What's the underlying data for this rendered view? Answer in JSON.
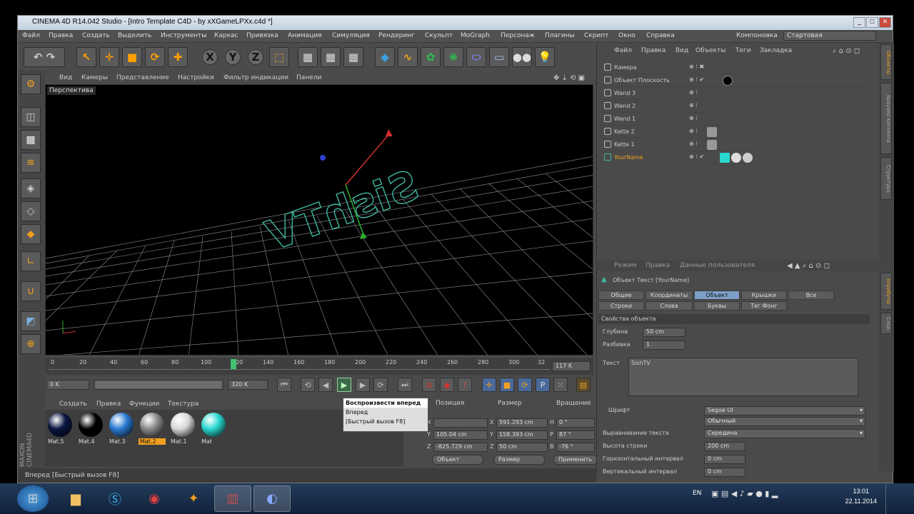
{
  "window": {
    "title": "CINEMA 4D R14.042 Studio - [Intro Template C4D - by xXGameLPXx.c4d *]"
  },
  "menu": [
    "Файл",
    "Правка",
    "Создать",
    "Выделить",
    "Инструменты",
    "Каркас",
    "Привязка",
    "Анимация",
    "Симуляция",
    "Рендеринг",
    "Скульпт",
    "MoGraph",
    "Персонаж",
    "Плагины",
    "Скрипт",
    "Окно",
    "Справка"
  ],
  "layout": {
    "label": "Компоновка",
    "value": "Стартовая"
  },
  "viewport": {
    "menu": [
      "Вид",
      "Камеры",
      "Представление",
      "Настройки",
      "Фильтр индикации",
      "Панели"
    ],
    "label": "Перспектива"
  },
  "timeline": {
    "ticks": [
      "0",
      "20",
      "40",
      "60",
      "80",
      "100",
      "120",
      "140",
      "160",
      "180",
      "200",
      "220",
      "240",
      "260",
      "280",
      "300",
      "32"
    ],
    "current": "117 K"
  },
  "transport": {
    "start": "0 K",
    "range_start": "0",
    "range_end": "320 K",
    "end": "320 K"
  },
  "tooltip": {
    "lines": [
      "Воспроизвести вперед",
      "Вперед",
      "[Быстрый вызов F8]"
    ]
  },
  "materials": {
    "menu": [
      "Создать",
      "Правка",
      "Функции",
      "Текстура"
    ],
    "items": [
      {
        "label": "Mat.5",
        "color": "#0a1640"
      },
      {
        "label": "Mat.4",
        "color": "#000000"
      },
      {
        "label": "Mat.3",
        "color": "#2a7ad0"
      },
      {
        "label": "Mat.2",
        "color": "#8a8a8a"
      },
      {
        "label": "Mat.1",
        "color": "#d8d8d8"
      },
      {
        "label": "Mat",
        "color": "#2ad8d0"
      }
    ]
  },
  "coords": {
    "headers": [
      "Позиция",
      "Размер",
      "Вращение"
    ],
    "position": [
      "X",
      "Y",
      "Z"
    ],
    "pos_values": [
      "",
      "105.04 cm",
      "-825.729 cm"
    ],
    "size_values": [
      "591.293 cm",
      "158.393 cm",
      "50 cm"
    ],
    "size_labels": [
      "X",
      "Y",
      "Z"
    ],
    "rot_labels": [
      "H",
      "P",
      "B"
    ],
    "rot_values": [
      "0 °",
      "87 °",
      "-76 °"
    ],
    "buttons": [
      "Объект",
      "Размер",
      "Применить"
    ]
  },
  "objects": {
    "menu": [
      "Файл",
      "Правка",
      "Вид",
      "Объекты",
      "Теги",
      "Закладка"
    ],
    "items": [
      {
        "name": "Камера",
        "color": "#cccccc"
      },
      {
        "name": "Объект Плоскость",
        "color": "#cccccc"
      },
      {
        "name": "Wand 3",
        "color": "#cccccc"
      },
      {
        "name": "Wand 2",
        "color": "#cccccc"
      },
      {
        "name": "Wand 1",
        "color": "#cccccc"
      },
      {
        "name": "Kette 2",
        "color": "#cccccc"
      },
      {
        "name": "Kette 1",
        "color": "#cccccc"
      },
      {
        "name": "YourName",
        "color": "#f0a020"
      }
    ]
  },
  "attributes": {
    "menu": [
      "Режим",
      "Правка",
      "Данные пользователя"
    ],
    "object_title": "Объект Текст [YourName]",
    "tabs_row1": [
      "Общие",
      "Координаты",
      "Объект",
      "Крышки",
      "Все"
    ],
    "tabs_row2": [
      "Строки",
      "Слова",
      "Буквы",
      "Тег Фонг"
    ],
    "section": "Свойства объекта",
    "depth_label": "Глубина",
    "depth_value": "50 cm",
    "subdiv_label": "Разбивка",
    "subdiv_value": "1",
    "text_label": "Текст",
    "text_value": "SishTV",
    "font_label": "Шрифт",
    "font_value": "Segoe UI",
    "font_style": "Обычный",
    "align_label": "Выравнивание текста",
    "align_value": "Середина",
    "line_height_label": "Высота строки",
    "line_height_value": "200 cm",
    "hspacing_label": "Горизонтальный интервал",
    "hspacing_value": "0 cm",
    "vspacing_label": "Вертикальный интервал",
    "vspacing_value": "0 cm"
  },
  "right_tabs": [
    "Объекты",
    "Браузер контента",
    "Структура",
    "Атрибуты",
    "Слои"
  ],
  "statusbar": "Вперед [Быстрый вызов F8]",
  "taskbar": {
    "lang": "EN",
    "time": "13:01",
    "date": "22.11.2014"
  }
}
